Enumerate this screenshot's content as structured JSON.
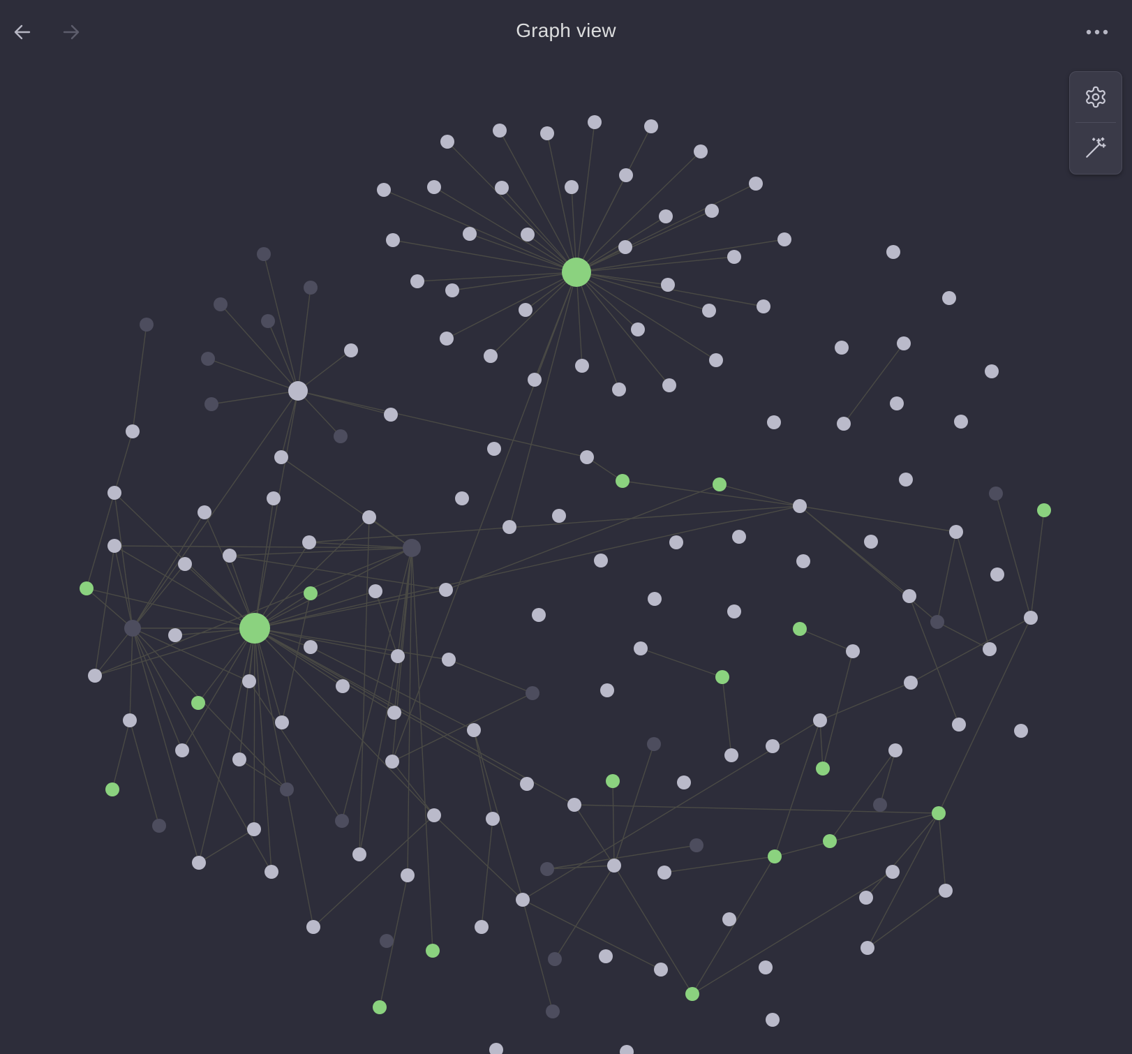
{
  "header": {
    "title": "Graph view"
  },
  "icons": {
    "back": "arrow-left-icon",
    "forward": "arrow-right-icon",
    "more": "more-horizontal-icon",
    "settings": "gear-icon",
    "animate": "magic-wand-icon"
  },
  "colors": {
    "background": "#2d2d3a",
    "node_default": "#babaca",
    "node_accent": "#8bd27f",
    "node_dim": "#4d4d5e",
    "edge": "#4a4a45",
    "text": "#dcddde"
  }
}
